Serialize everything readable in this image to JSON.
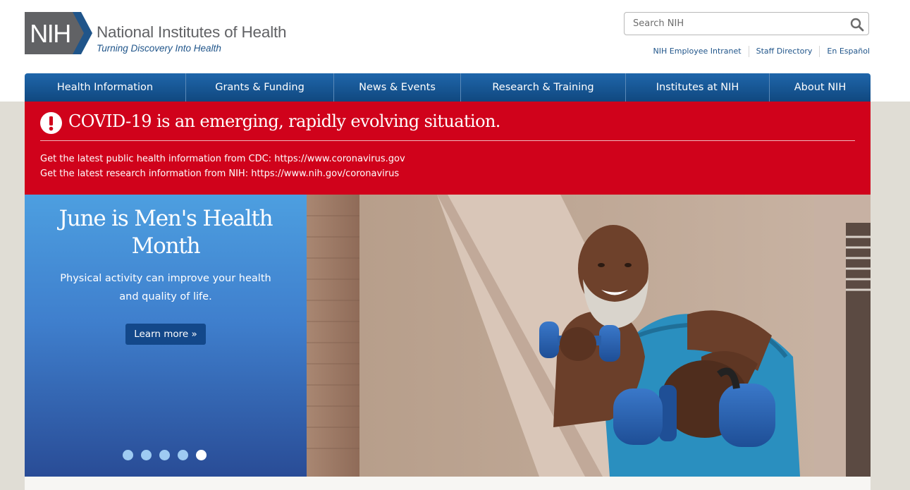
{
  "header": {
    "logo_text": "NIH",
    "org_name": "National Institutes of Health",
    "tagline": "Turning Discovery Into Health"
  },
  "search": {
    "placeholder": "Search NIH",
    "icon": "search-icon"
  },
  "utility_links": [
    {
      "label": "NIH Employee Intranet"
    },
    {
      "label": "Staff Directory"
    },
    {
      "label": "En Español"
    }
  ],
  "nav": {
    "items": [
      {
        "label": "Health Information"
      },
      {
        "label": "Grants & Funding"
      },
      {
        "label": "News & Events"
      },
      {
        "label": "Research & Training"
      },
      {
        "label": "Institutes at NIH"
      },
      {
        "label": "About NIH"
      }
    ]
  },
  "alert": {
    "icon": "exclamation-icon",
    "title": "COVID-19 is an emerging, rapidly evolving situation.",
    "lines": [
      "Get the latest public health information from CDC: https://www.coronavirus.gov",
      "Get the latest research information from NIH: https://www.nih.gov/coronavirus"
    ]
  },
  "hero": {
    "title": "June is Men's Health Month",
    "description": "Physical activity can improve your health and quality of life.",
    "button_label": "Learn more »",
    "slide_count": 5,
    "active_slide": 5
  },
  "colors": {
    "brand_blue": "#20558a",
    "nav_blue": "#1f66ab",
    "alert_red": "#d0021b",
    "logo_gray": "#616265",
    "page_bg": "#e0ddd5"
  }
}
